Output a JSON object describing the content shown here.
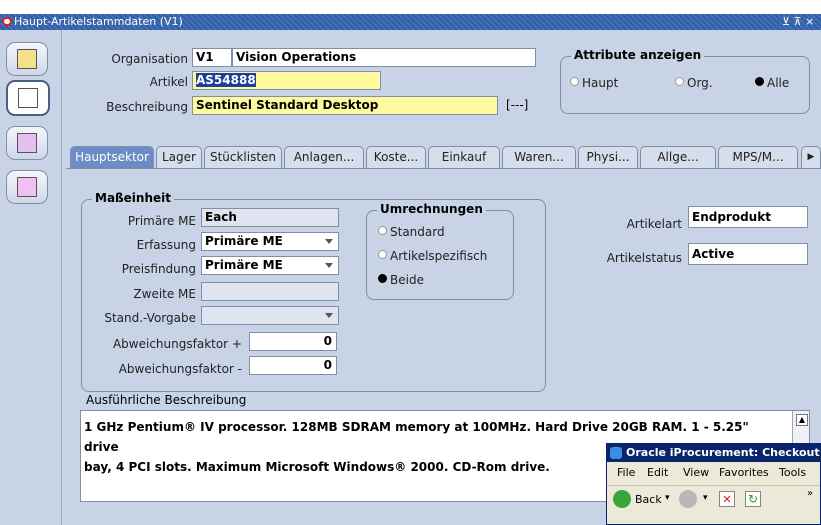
{
  "window": {
    "title": "Haupt-Artikelstammdaten (V1)",
    "controls": "⊻ ⊼ ×"
  },
  "header": {
    "organisation_label": "Organisation",
    "organisation_code": "V1",
    "organisation_name": "Vision Operations",
    "artikel_label": "Artikel",
    "artikel_value": "AS54888",
    "beschreibung_label": "Beschreibung",
    "beschreibung_value": "Sentinel Standard Desktop",
    "bracket_button": "[---]",
    "attribute_group": "Attribute anzeigen",
    "attr_options": [
      "Haupt",
      "Org.",
      "Alle"
    ],
    "attr_selected": "Alle"
  },
  "tabs": [
    "Hauptsektor",
    "Lager",
    "Stücklisten",
    "Anlagen...",
    "Koste...",
    "Einkauf",
    "Waren...",
    "Physi...",
    "Allge...",
    "MPS/M..."
  ],
  "active_tab": "Hauptsektor",
  "masseinheit": {
    "group_title": "Maßeinheit",
    "primaere_me_label": "Primäre ME",
    "primaere_me_value": "Each",
    "erfassung_label": "Erfassung",
    "erfassung_value": "Primäre ME",
    "preisfindung_label": "Preisfindung",
    "preisfindung_value": "Primäre ME",
    "zweite_me_label": "Zweite ME",
    "zweite_me_value": "",
    "stand_vorgabe_label": "Stand.-Vorgabe",
    "stand_vorgabe_value": "",
    "abw_plus_label": "Abweichungsfaktor +",
    "abw_plus_value": "0",
    "abw_minus_label": "Abweichungsfaktor -",
    "abw_minus_value": "0"
  },
  "umrechnungen": {
    "group_title": "Umrechnungen",
    "options": [
      "Standard",
      "Artikelspezifisch",
      "Beide"
    ],
    "selected": "Beide"
  },
  "right": {
    "artikelart_label": "Artikelart",
    "artikelart_value": "Endprodukt",
    "artikelstatus_label": "Artikelstatus",
    "artikelstatus_value": "Active"
  },
  "description": {
    "label": "Ausführliche Beschreibung",
    "line1": "1 GHz Pentium® IV processor.  128MB SDRAM memory at 100MHz.  Hard Drive 20GB RAM.  1 - 5.25\" drive",
    "line2": "bay, 4 PCI slots.  Maximum Microsoft Windows® 2000.  CD-Rom drive."
  },
  "popup": {
    "title": "Oracle iProcurement: Checkout - M",
    "menu": [
      "File",
      "Edit",
      "View",
      "Favorites",
      "Tools"
    ],
    "back_label": "Back"
  }
}
